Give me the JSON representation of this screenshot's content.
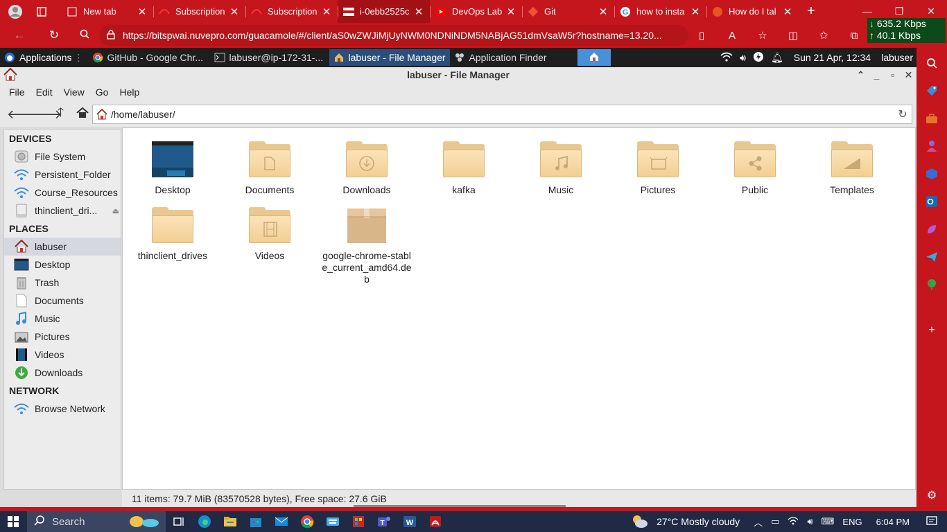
{
  "browser": {
    "tabs": [
      {
        "title": "New tab",
        "icon": "newtab-icon",
        "active": false
      },
      {
        "title": "Subscription",
        "icon": "redhat-icon",
        "active": false
      },
      {
        "title": "Subscription",
        "icon": "redhat-icon",
        "active": false
      },
      {
        "title": "i-0ebb2525c",
        "icon": "flag-icon",
        "active": true
      },
      {
        "title": "DevOps Lab",
        "icon": "youtube-icon",
        "active": false
      },
      {
        "title": "Git",
        "icon": "git-icon",
        "active": false
      },
      {
        "title": "how to insta",
        "icon": "google-icon",
        "active": false
      },
      {
        "title": "How do I tal",
        "icon": "askubuntu-icon",
        "active": false
      }
    ],
    "url": "https://bitspwai.nuvepro.com/guacamole/#/client/aS0wZWJiMjUyNWM0NDNiNDM5NABjAG51dmVsaW5r?hostname=13.20...",
    "net_down": "635.2 Kbps",
    "net_up": "40.1 Kbps",
    "accent": "#c4161c"
  },
  "xfce_panel": {
    "applications": "Applications",
    "tasks": [
      {
        "title": "GitHub - Google Chr...",
        "icon": "chrome-icon",
        "active": false
      },
      {
        "title": "labuser@ip-172-31-...",
        "icon": "terminal-icon",
        "active": false
      },
      {
        "title": "labuser - File Manager",
        "icon": "home-folder-icon",
        "active": true
      },
      {
        "title": "Application Finder",
        "icon": "app-finder-icon",
        "active": false
      }
    ],
    "datetime": "Sun 21 Apr, 12:34",
    "user": "labuser"
  },
  "file_manager": {
    "title": "labuser - File Manager",
    "menu": [
      "File",
      "Edit",
      "View",
      "Go",
      "Help"
    ],
    "path": "/home/labuser/",
    "sidebar": {
      "devices_header": "DEVICES",
      "devices": [
        {
          "label": "File System",
          "icon": "harddisk-icon"
        },
        {
          "label": "Persistent_Folder",
          "icon": "network-share-icon"
        },
        {
          "label": "Course_Resources",
          "icon": "network-share-icon"
        },
        {
          "label": "thinclient_dri...",
          "icon": "drive-icon"
        }
      ],
      "places_header": "PLACES",
      "places": [
        {
          "label": "labuser",
          "icon": "home-icon",
          "selected": true
        },
        {
          "label": "Desktop",
          "icon": "desktop-icon"
        },
        {
          "label": "Trash",
          "icon": "trash-icon"
        },
        {
          "label": "Documents",
          "icon": "documents-icon"
        },
        {
          "label": "Music",
          "icon": "music-icon"
        },
        {
          "label": "Pictures",
          "icon": "pictures-icon"
        },
        {
          "label": "Videos",
          "icon": "videos-icon"
        },
        {
          "label": "Downloads",
          "icon": "downloads-icon"
        }
      ],
      "network_header": "NETWORK",
      "network": [
        {
          "label": "Browse Network",
          "icon": "network-icon"
        }
      ]
    },
    "files": [
      {
        "name": "Desktop",
        "icon": "desktop-folder-icon"
      },
      {
        "name": "Documents",
        "icon": "documents-folder-icon"
      },
      {
        "name": "Downloads",
        "icon": "downloads-folder-icon"
      },
      {
        "name": "kafka",
        "icon": "folder-icon"
      },
      {
        "name": "Music",
        "icon": "music-folder-icon"
      },
      {
        "name": "Pictures",
        "icon": "pictures-folder-icon"
      },
      {
        "name": "Public",
        "icon": "public-folder-icon"
      },
      {
        "name": "Templates",
        "icon": "templates-folder-icon"
      },
      {
        "name": "thinclient_drives",
        "icon": "folder-icon"
      },
      {
        "name": "Videos",
        "icon": "videos-folder-icon"
      },
      {
        "name": "google-chrome-stable_current_amd64.deb",
        "icon": "package-icon"
      }
    ],
    "status": "11 items: 79.7 MiB (83570528 bytes), Free space: 27.6 GiB"
  },
  "taskbar": {
    "search": "Search",
    "weather": "27°C  Mostly cloudy",
    "lang": "ENG",
    "time": "6:04 PM"
  }
}
